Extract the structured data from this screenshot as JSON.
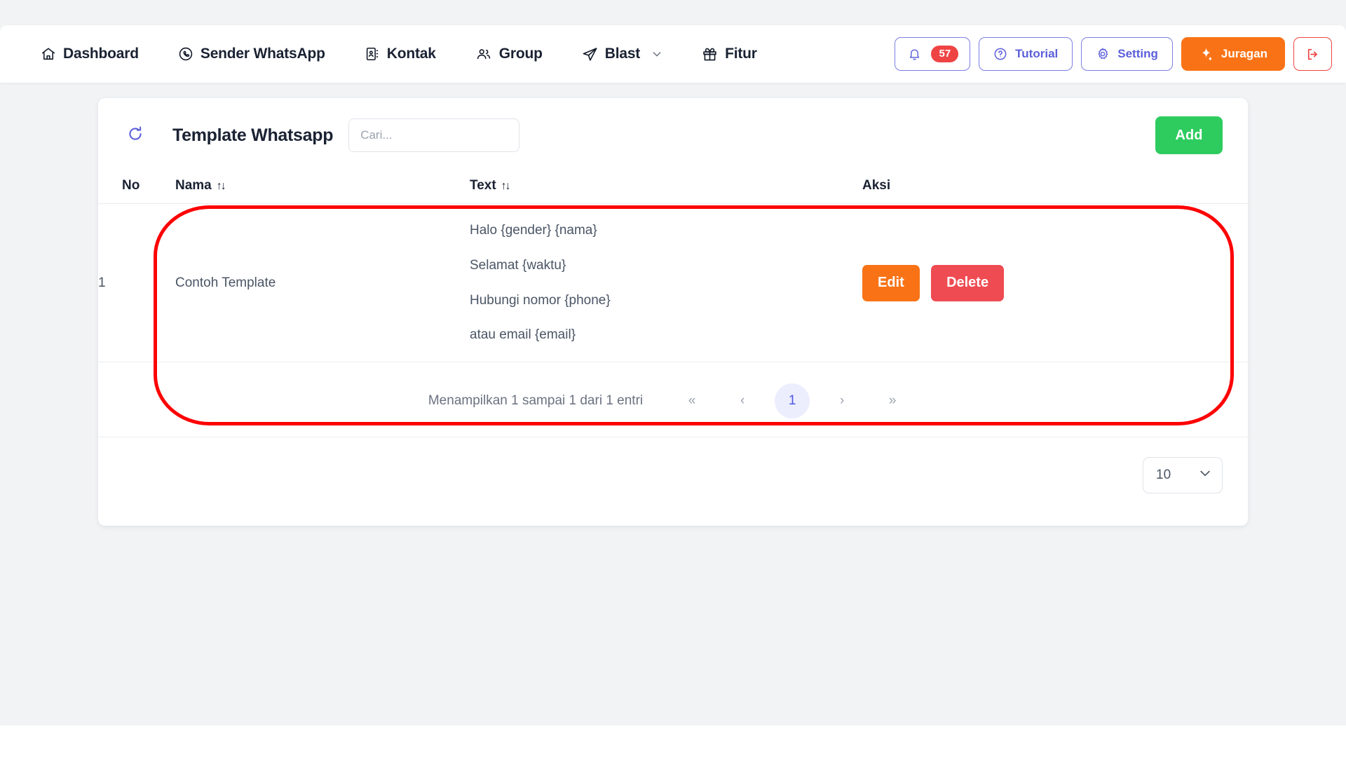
{
  "navbar": {
    "items": [
      {
        "label": "Dashboard",
        "icon": "home-icon",
        "dropdown": false
      },
      {
        "label": "Sender WhatsApp",
        "icon": "whatsapp-icon",
        "dropdown": false
      },
      {
        "label": "Kontak",
        "icon": "contact-book-icon",
        "dropdown": false
      },
      {
        "label": "Group",
        "icon": "people-icon",
        "dropdown": false
      },
      {
        "label": "Blast",
        "icon": "send-icon",
        "dropdown": true
      },
      {
        "label": "Fitur",
        "icon": "gift-icon",
        "dropdown": false
      }
    ],
    "notification": {
      "icon": "bell-icon",
      "count": "57"
    },
    "tutorial": {
      "label": "Tutorial",
      "icon": "question-circle-icon"
    },
    "setting": {
      "label": "Setting",
      "icon": "gear-icon"
    },
    "juragan": {
      "label": "Juragan",
      "icon": "sparkle-icon"
    },
    "logout": {
      "icon": "logout-icon"
    }
  },
  "card": {
    "refresh_icon": "refresh-icon",
    "title": "Template Whatsapp",
    "search_placeholder": "Cari...",
    "search_value": "",
    "add_label": "Add"
  },
  "table": {
    "headers": {
      "no": "No",
      "nama": "Nama",
      "text": "Text",
      "aksi": "Aksi",
      "sort_glyph": "↑↓"
    },
    "rows": [
      {
        "no": "1",
        "nama": "Contoh Template",
        "text_lines": [
          "Halo {gender} {nama}",
          "Selamat {waktu}",
          "Hubungi nomor {phone}",
          "atau email {email}"
        ],
        "edit_label": "Edit",
        "delete_label": "Delete"
      }
    ]
  },
  "pagination": {
    "info": "Menampilkan 1 sampai 1 dari 1 entri",
    "first": "«",
    "prev": "‹",
    "current": "1",
    "next": "›",
    "last": "»"
  },
  "per_page": {
    "value": "10",
    "chevron": "chevron-down-icon"
  },
  "annotation": {
    "type": "rounded-rectangle-highlight",
    "color": "#fd0000"
  },
  "colors": {
    "page_background": "#f1f3f5",
    "accent_indigo": "#5b5fd9",
    "add_green": "#2ecc5f",
    "edit_orange": "#f97316",
    "delete_red": "#ef4b52",
    "badge_red": "#ef4444",
    "annotation_red": "#fd0000"
  }
}
